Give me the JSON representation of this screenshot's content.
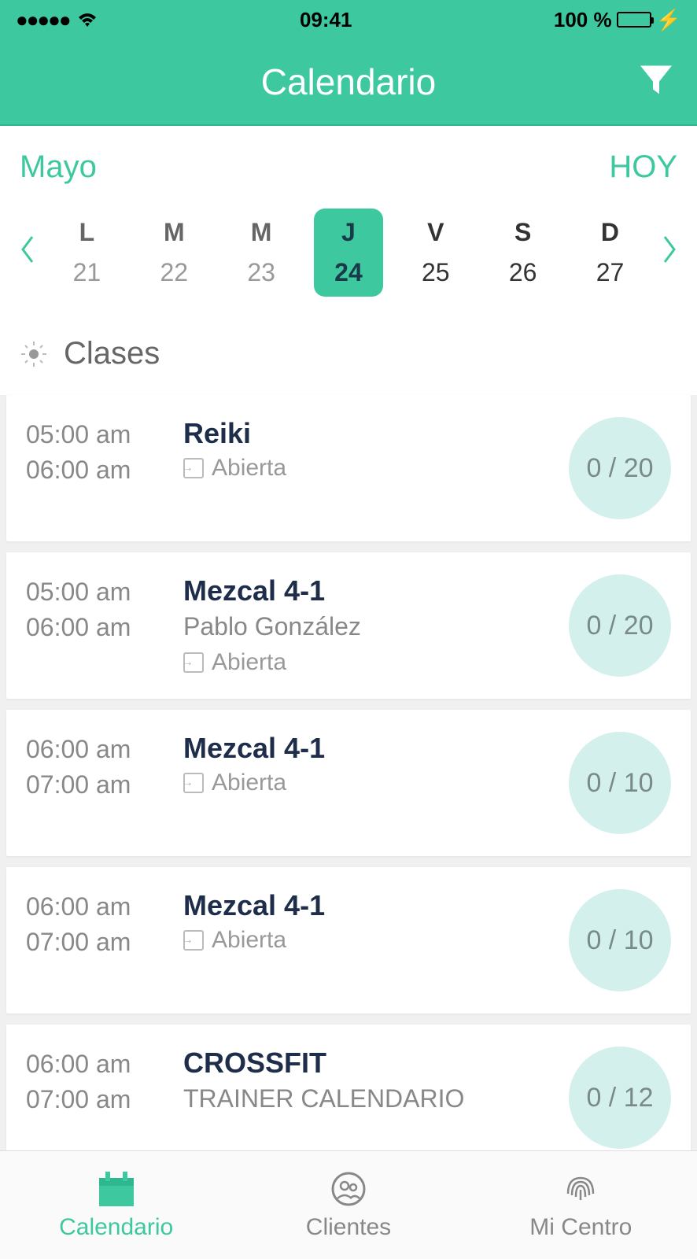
{
  "status": {
    "time": "09:41",
    "battery_pct": "100 %"
  },
  "header": {
    "title": "Calendario"
  },
  "month_row": {
    "month": "Mayo",
    "today": "HOY"
  },
  "days": [
    {
      "letter": "L",
      "number": "21",
      "state": "past"
    },
    {
      "letter": "M",
      "number": "22",
      "state": "past"
    },
    {
      "letter": "M",
      "number": "23",
      "state": "past"
    },
    {
      "letter": "J",
      "number": "24",
      "state": "selected"
    },
    {
      "letter": "V",
      "number": "25",
      "state": "future"
    },
    {
      "letter": "S",
      "number": "26",
      "state": "future"
    },
    {
      "letter": "D",
      "number": "27",
      "state": "future"
    }
  ],
  "section": {
    "label": "Clases"
  },
  "classes": [
    {
      "start": "05:00 am",
      "end": "06:00 am",
      "name": "Reiki",
      "instructor": "",
      "status": "Abierta",
      "count": "0 / 20"
    },
    {
      "start": "05:00 am",
      "end": "06:00 am",
      "name": "Mezcal 4-1",
      "instructor": "Pablo González",
      "status": "Abierta",
      "count": "0 / 20"
    },
    {
      "start": "06:00 am",
      "end": "07:00 am",
      "name": "Mezcal 4-1",
      "instructor": "",
      "status": "Abierta",
      "count": "0 / 10"
    },
    {
      "start": "06:00 am",
      "end": "07:00 am",
      "name": "Mezcal 4-1",
      "instructor": "",
      "status": "Abierta",
      "count": "0 / 10"
    },
    {
      "start": "06:00 am",
      "end": "07:00 am",
      "name": "CROSSFIT",
      "instructor": "TRAINER CALENDARIO",
      "status": "",
      "count": "0 / 12"
    }
  ],
  "tabs": {
    "calendar": "Calendario",
    "clients": "Clientes",
    "center": "Mi Centro"
  }
}
